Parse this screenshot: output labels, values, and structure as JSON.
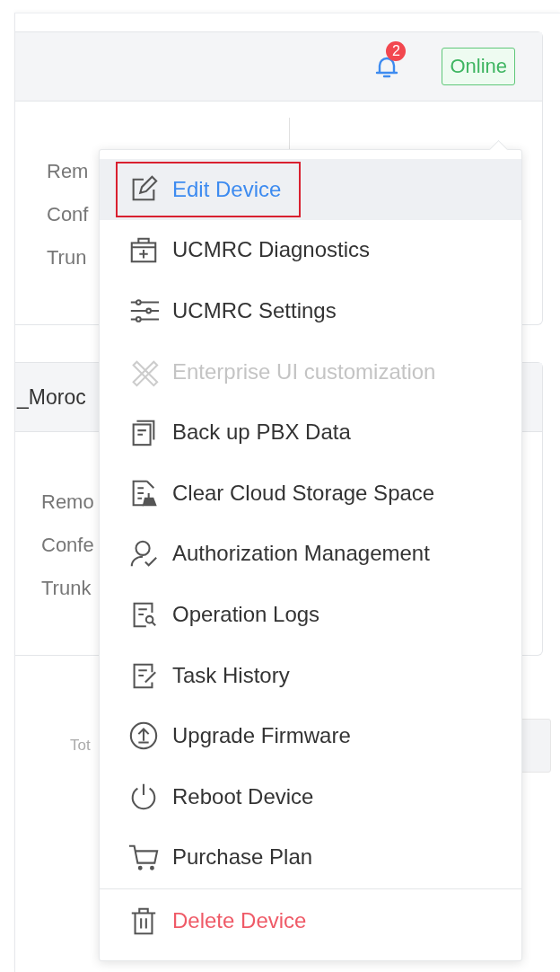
{
  "header": {
    "notification_count": "2",
    "status": "Online"
  },
  "cards": [
    {
      "fields": [
        "Rem",
        "Conf",
        "Trun"
      ]
    },
    {
      "title": "_Moroc",
      "fields": [
        "Remo",
        "Confe",
        "Trunk"
      ]
    }
  ],
  "footer": {
    "label": "Tot"
  },
  "menu": {
    "items": [
      {
        "label": "Edit Device",
        "kind": "normal",
        "selected": true,
        "disabled": false,
        "outlined": true
      },
      {
        "label": "UCMRC Diagnostics",
        "kind": "normal",
        "selected": false,
        "disabled": false,
        "outlined": false
      },
      {
        "label": "UCMRC Settings",
        "kind": "normal",
        "selected": false,
        "disabled": false,
        "outlined": false
      },
      {
        "label": "Enterprise UI customization",
        "kind": "normal",
        "selected": false,
        "disabled": true,
        "outlined": false
      },
      {
        "label": "Back up PBX Data",
        "kind": "normal",
        "selected": false,
        "disabled": false,
        "outlined": false
      },
      {
        "label": "Clear Cloud Storage Space",
        "kind": "normal",
        "selected": false,
        "disabled": false,
        "outlined": false
      },
      {
        "label": "Authorization Management",
        "kind": "normal",
        "selected": false,
        "disabled": false,
        "outlined": false
      },
      {
        "label": "Operation Logs",
        "kind": "normal",
        "selected": false,
        "disabled": false,
        "outlined": false
      },
      {
        "label": "Task History",
        "kind": "normal",
        "selected": false,
        "disabled": false,
        "outlined": false
      },
      {
        "label": "Upgrade Firmware",
        "kind": "normal",
        "selected": false,
        "disabled": false,
        "outlined": false
      },
      {
        "label": "Reboot Device",
        "kind": "normal",
        "selected": false,
        "disabled": false,
        "outlined": false
      },
      {
        "label": "Purchase Plan",
        "kind": "normal",
        "selected": false,
        "disabled": false,
        "outlined": false
      },
      {
        "label": "Delete Device",
        "kind": "danger",
        "selected": false,
        "disabled": false,
        "outlined": false
      }
    ]
  }
}
